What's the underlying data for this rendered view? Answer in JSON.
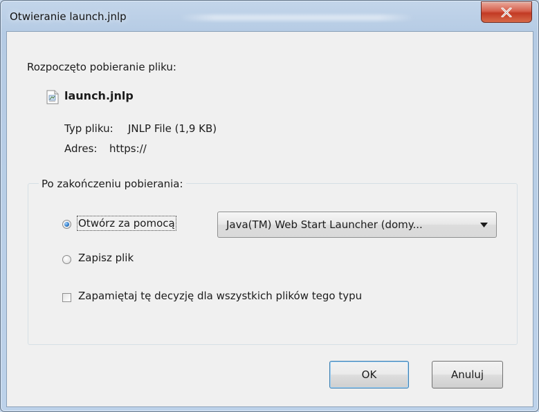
{
  "window": {
    "title": "Otwieranie launch.jnlp",
    "close_glyph": "X"
  },
  "dialog": {
    "intro": "Rozpoczęto pobieranie pliku:",
    "file": {
      "name": "launch.jnlp",
      "icon": "jnlp-file-icon",
      "type_label": "Typ pliku:",
      "type_value": "JNLP File (1,9 KB)",
      "address_label": "Adres:",
      "address_value": "https://"
    },
    "after_download": {
      "legend": "Po zakończeniu pobierania:",
      "open_with": {
        "label": "Otwórz za pomocą",
        "checked": true
      },
      "application": {
        "selected": "Java(TM) Web Start Launcher (domy..."
      },
      "save_file": {
        "label": "Zapisz plik",
        "checked": false
      },
      "remember": {
        "label": "Zapamiętaj tę decyzję dla wszystkich plików tego typu",
        "checked": false
      }
    },
    "buttons": {
      "ok": "OK",
      "cancel": "Anuluj"
    }
  },
  "colors": {
    "title_frame": "#bdd2ea",
    "client_background": "#f0f0f0",
    "close_button": "#c23a24",
    "radio_accent": "#2b78c6"
  }
}
